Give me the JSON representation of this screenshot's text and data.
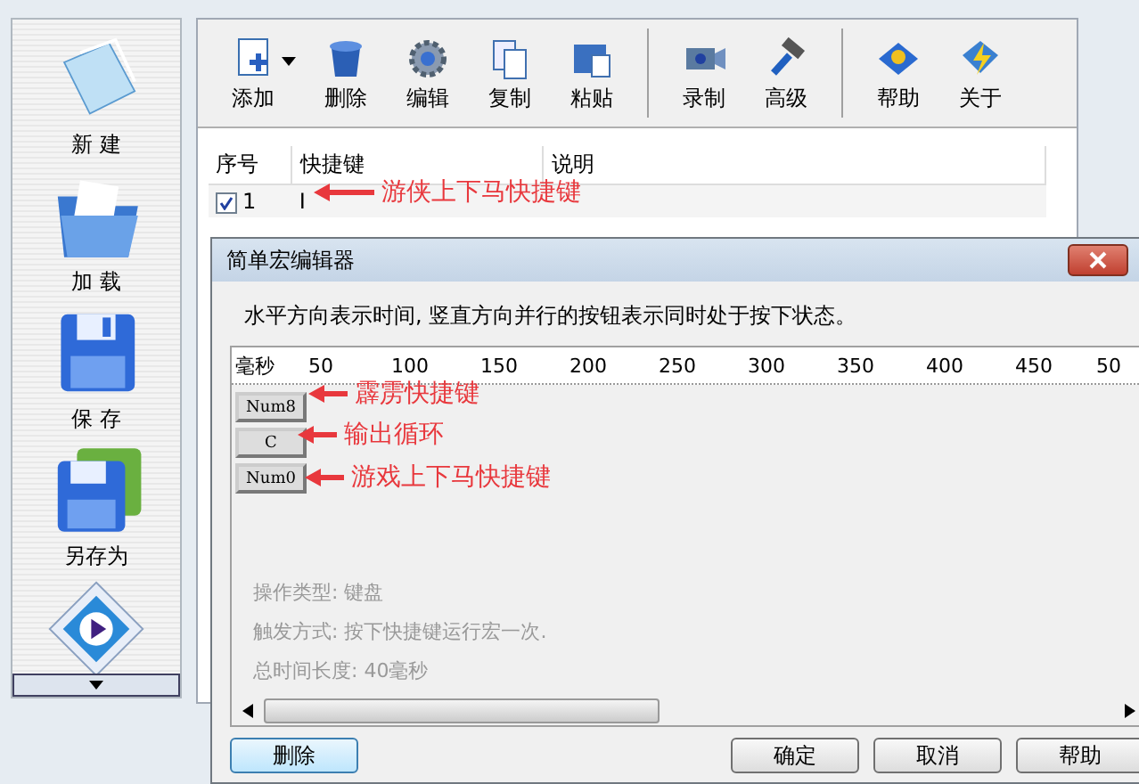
{
  "sidebar": {
    "items": [
      {
        "kind": "button",
        "label": "新 建"
      },
      {
        "kind": "button",
        "label": "加 载"
      },
      {
        "kind": "button",
        "label": "保 存"
      },
      {
        "kind": "button",
        "label": "另存为"
      },
      {
        "kind": "icon"
      }
    ]
  },
  "toolbar": {
    "groups": [
      [
        {
          "label": "添加",
          "dropdown": true
        },
        {
          "label": "删除",
          "dropdown": false
        },
        {
          "label": "编辑",
          "dropdown": false
        },
        {
          "label": "复制",
          "dropdown": false
        },
        {
          "label": "粘贴",
          "dropdown": false
        }
      ],
      [
        {
          "label": "录制",
          "dropdown": false
        },
        {
          "label": "高级",
          "dropdown": false
        }
      ],
      [
        {
          "label": "帮助",
          "dropdown": false
        },
        {
          "label": "关于",
          "dropdown": false
        }
      ]
    ]
  },
  "table": {
    "columns": [
      "序号",
      "快捷键",
      "说明"
    ],
    "rows": [
      {
        "checked": true,
        "number": "1",
        "key": "I"
      }
    ]
  },
  "dialog": {
    "title": "简单宏编辑器",
    "description": "水平方向表示时间, 竖直方向并行的按钮表示同时处于按下状态。",
    "ruler": {
      "unit": "毫秒",
      "ticks": [
        "50",
        "100",
        "150",
        "200",
        "250",
        "300",
        "350",
        "400",
        "450",
        "50"
      ]
    },
    "keys": [
      {
        "label": "Num8"
      },
      {
        "label": "C"
      },
      {
        "label": "Num0"
      }
    ],
    "info": [
      "操作类型: 键盘",
      "触发方式: 按下快捷键运行宏一次.",
      "总时间长度: 40毫秒"
    ],
    "buttons_left": [
      "删除"
    ],
    "buttons_right": [
      "确定",
      "取消",
      "帮助"
    ]
  },
  "annotations": [
    {
      "text": "游侠上下马快捷键"
    },
    {
      "text": "霹雳快捷键"
    },
    {
      "text": "输出循环"
    },
    {
      "text": "游戏上下马快捷键"
    }
  ]
}
